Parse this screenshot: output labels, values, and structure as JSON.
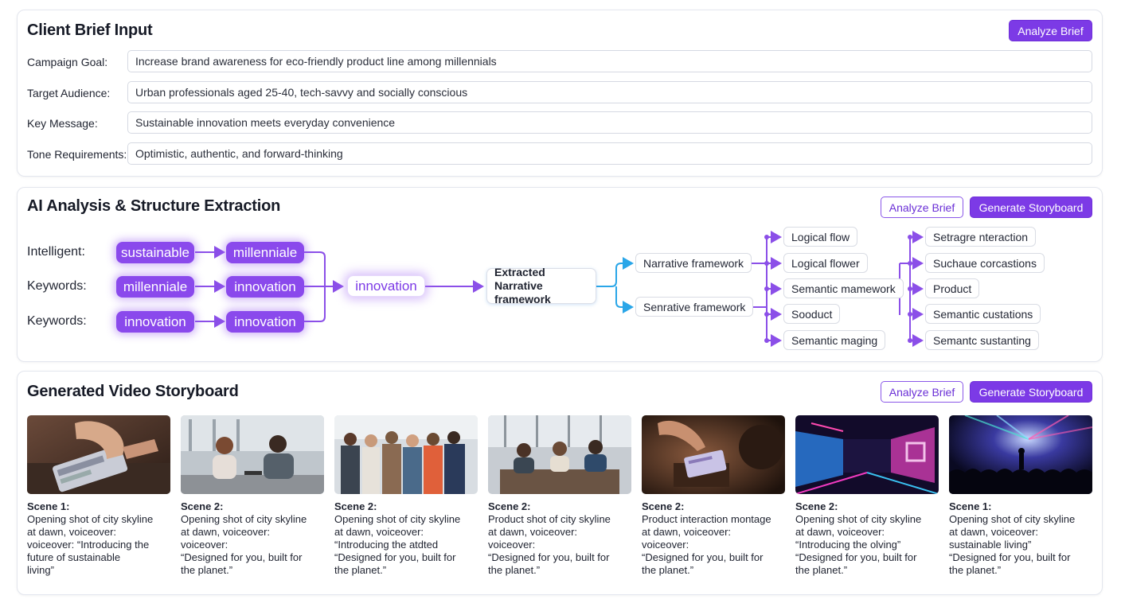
{
  "brief": {
    "title": "Client Brief Input",
    "analyze_label": "Analyze Brief",
    "fields": [
      {
        "label": "Campaign Goal:",
        "value": "Increase brand awareness for eco-friendly product line among millennials"
      },
      {
        "label": "Target Audience:",
        "value": "Urban professionals aged 25-40, tech-savvy and socially conscious"
      },
      {
        "label": "Key Message:",
        "value": "Sustainable innovation meets everyday convenience"
      },
      {
        "label": "Tone Requirements:",
        "value": "Optimistic, authentic, and forward-thinking"
      }
    ]
  },
  "analysis": {
    "title": "AI Analysis & Structure Extraction",
    "analyze_label": "Analyze Brief",
    "generate_label": "Generate Storyboard",
    "row_labels": [
      "Intelligent:",
      "Keywords:",
      "Keywords:"
    ],
    "pills": [
      [
        "sustainable",
        "millenniale"
      ],
      [
        "millenniale",
        "innovation"
      ],
      [
        "innovation",
        "innovation"
      ]
    ],
    "merge_pill": "innovation",
    "extracted": "Extracted Narrative framework",
    "frameworks": [
      "Narrative framework",
      "Senrative framework"
    ],
    "col1": [
      "Logical flow",
      "Logical flower",
      "Semantic mamework",
      "Sooduct",
      "Semantic maging"
    ],
    "col2": [
      "Setragre nteraction",
      "Suchaue corcastions",
      "Product",
      "Semantic custations",
      "Semantc sustanting"
    ]
  },
  "storyboard": {
    "title": "Generated Video Storyboard",
    "analyze_label": "Analyze Brief",
    "generate_label": "Generate Storyboard",
    "scenes": [
      {
        "title": "Scene 1:",
        "lines": [
          "Opening shot of city skyline",
          "at dawn, voiceover:",
          "voiceover: “Introducing the",
          "future of sustainable",
          "living”"
        ],
        "image": "hand-holding-eco-product"
      },
      {
        "title": "Scene 2:",
        "lines": [
          "Opening shot of city skyline",
          "at dawn, voiceover:",
          "voiceover:",
          "“Designed for you, built for",
          "the planet.”"
        ],
        "image": "two-people-conversation"
      },
      {
        "title": "Scene 2:",
        "lines": [
          "Opening shot of city skyline",
          "at dawn, voiceover:",
          "“Introducing the atdted",
          "“Designed for you, built for",
          "the planet.”"
        ],
        "image": "group-of-people"
      },
      {
        "title": "Scene 2:",
        "lines": [
          "Product shot of city skyline",
          "at dawn, voiceover:",
          "voiceover:",
          "“Designed for you, built for",
          "the planet.”"
        ],
        "image": "office-meeting"
      },
      {
        "title": "Scene 2:",
        "lines": [
          "Product interaction montage",
          "at dawn, voiceover:",
          "voiceover:",
          "“Designed for you, built for",
          "the planet.”"
        ],
        "image": "product-interaction"
      },
      {
        "title": "Scene 2:",
        "lines": [
          "Opening shot of city skyline",
          "at dawn, voiceover:",
          "“Introducing the olving”",
          "“Designed for you, built for",
          "the planet.”"
        ],
        "image": "neon-stage"
      },
      {
        "title": "Scene 1:",
        "lines": [
          "Opening shot of city skyline",
          "at dawn, voiceover:",
          "sustainable living”",
          "“Designed for you, built for",
          "the planet.”"
        ],
        "image": "concert-crowd"
      }
    ]
  },
  "colors": {
    "accent": "#7c3ae6",
    "connector_purple": "#8b4fe8",
    "connector_blue": "#2aa6e8"
  }
}
